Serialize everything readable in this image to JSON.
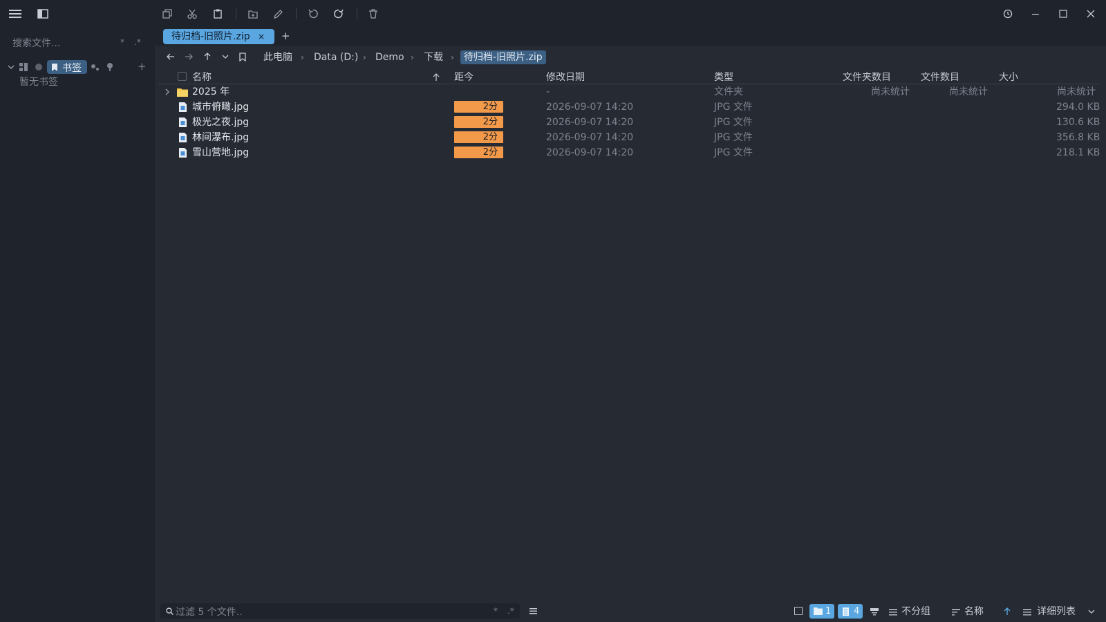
{
  "colors": {
    "accent": "#5aa6e0",
    "badge": "#f2994a",
    "folder": "#f4c84a",
    "bg": "#1f232b",
    "panel": "#262a33"
  },
  "sidebar": {
    "search_placeholder": "搜索文件...",
    "search_opt1": "*",
    "search_opt2": ".*",
    "bookmark_label": "书签",
    "add": "+",
    "empty_text": "暂无书签"
  },
  "tabs": [
    {
      "label": "待归档-旧照片.zip",
      "close": "×"
    }
  ],
  "new_tab": "+",
  "breadcrumb": [
    "此电脑",
    "Data (D:)",
    "Demo",
    "下载",
    "待归档-旧照片.zip"
  ],
  "columns": {
    "name": "名称",
    "since": "距今",
    "modified": "修改日期",
    "type": "类型",
    "folder_count": "文件夹数目",
    "file_count": "文件数目",
    "size": "大小"
  },
  "rows": [
    {
      "name": "2025 年",
      "since": "",
      "modified": "-",
      "type": "文件夹",
      "folder_count": "尚未统计",
      "file_count": "尚未统计",
      "size": "尚未统计",
      "icon": "folder-icon"
    },
    {
      "name": "城市俯瞰.jpg",
      "since": "2分",
      "modified": "2026-09-07 14:20",
      "type": "JPG 文件",
      "size": "294.0 KB",
      "icon": "image-file-icon"
    },
    {
      "name": "极光之夜.jpg",
      "since": "2分",
      "modified": "2026-09-07 14:20",
      "type": "JPG 文件",
      "size": "130.6 KB",
      "icon": "image-file-icon"
    },
    {
      "name": "林间瀑布.jpg",
      "since": "2分",
      "modified": "2026-09-07 14:20",
      "type": "JPG 文件",
      "size": "356.8 KB",
      "icon": "image-file-icon"
    },
    {
      "name": "雪山营地.jpg",
      "since": "2分",
      "modified": "2026-09-07 14:20",
      "type": "JPG 文件",
      "size": "218.1 KB",
      "icon": "image-file-icon"
    }
  ],
  "statusbar": {
    "filter_placeholder": "过滤 5 个文件..",
    "filter_opt1": "*",
    "filter_opt2": ".*",
    "folders_count": "1",
    "files_count": "4",
    "group_label": "不分组",
    "sort_label": "名称",
    "view_label": "详细列表"
  }
}
